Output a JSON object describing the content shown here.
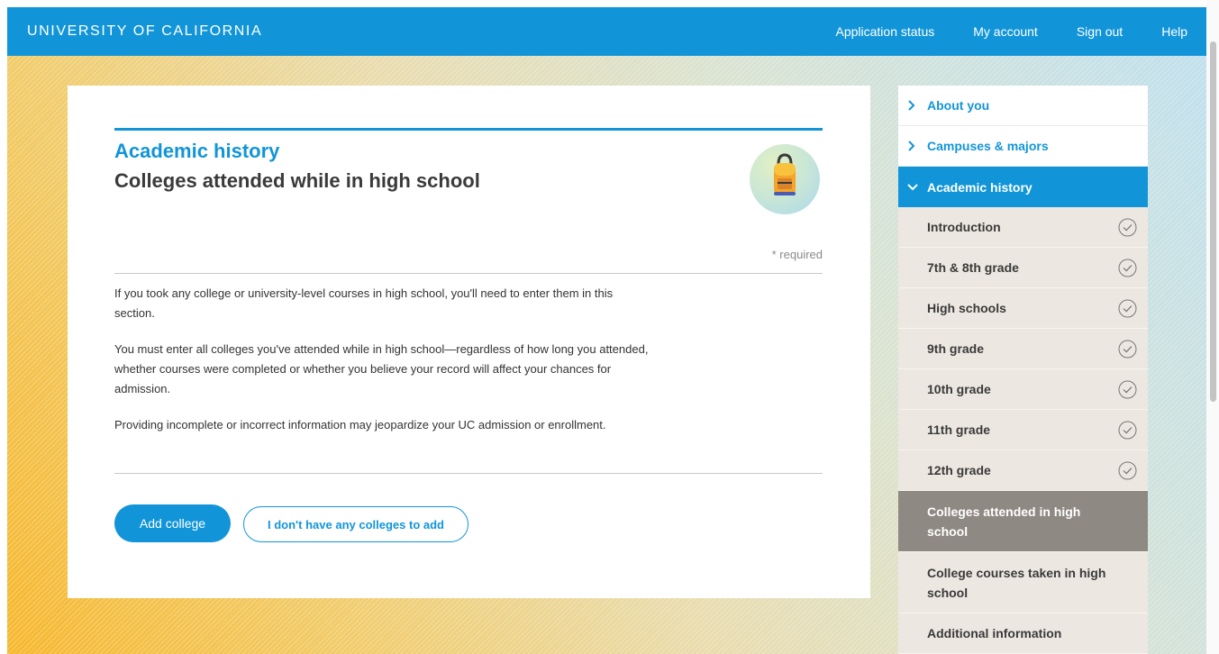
{
  "header": {
    "brand": "UNIVERSITY OF CALIFORNIA",
    "nav": [
      "Application status",
      "My account",
      "Sign out",
      "Help"
    ]
  },
  "main": {
    "section_title": "Academic history",
    "subtitle": "Colleges attended while in high school",
    "icon": "backpack-icon",
    "required_note": "* required",
    "paragraphs": [
      "If you took any college or university-level courses in high school, you'll need to enter them in this section.",
      "You must enter all colleges you've attended while in high school—regardless of how long you attended, whether courses were completed or whether you believe your record will affect your chances for admission.",
      "Providing incomplete or incorrect information may jeopardize your UC admission or enrollment."
    ],
    "buttons": {
      "add": "Add college",
      "none": "I don't have any colleges to add"
    }
  },
  "sidebar": {
    "sections": [
      {
        "label": "About you",
        "icon": "chevron-right-icon"
      },
      {
        "label": "Campuses & majors",
        "icon": "chevron-right-icon"
      },
      {
        "label": "Academic history",
        "icon": "chevron-down-icon",
        "expanded": true
      }
    ],
    "subitems": [
      {
        "label": "Introduction",
        "complete": true
      },
      {
        "label": "7th & 8th grade",
        "complete": true
      },
      {
        "label": "High schools",
        "complete": true
      },
      {
        "label": "9th grade",
        "complete": true
      },
      {
        "label": "10th grade",
        "complete": true
      },
      {
        "label": "11th grade",
        "complete": true
      },
      {
        "label": "12th grade",
        "complete": true
      },
      {
        "label": "Colleges attended in high school",
        "current": true
      },
      {
        "label": "College courses taken in high school"
      },
      {
        "label": "Additional information"
      }
    ]
  },
  "colors": {
    "accent": "#1295d8",
    "current_item": "#8f8983",
    "subitem_bg": "#ece7e1"
  }
}
